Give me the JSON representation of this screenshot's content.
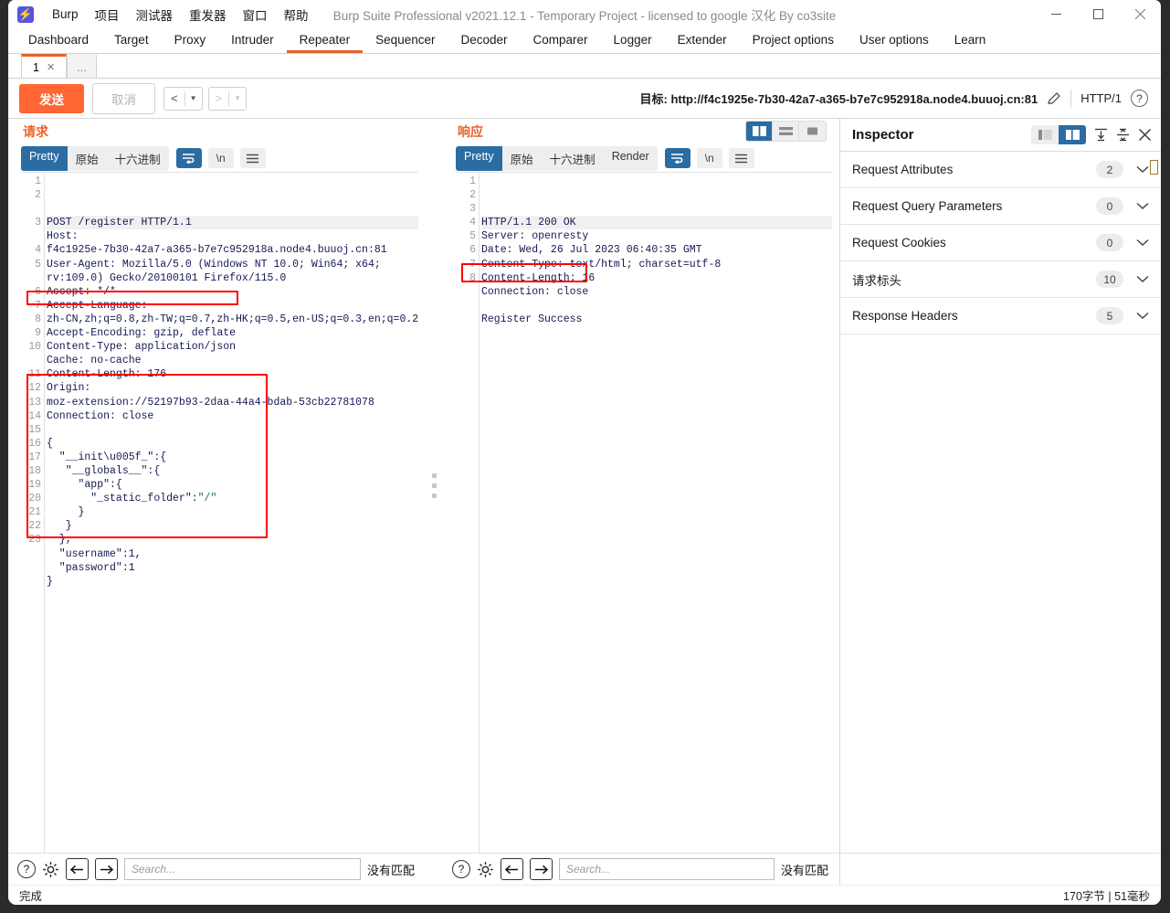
{
  "window": {
    "title": "Burp Suite Professional v2021.12.1 - Temporary Project - licensed to google 汉化 By co3site",
    "logo_glyph": "⚡",
    "minimize": "—",
    "maximize": "□",
    "close": "✕"
  },
  "menu": [
    {
      "label": "Burp"
    },
    {
      "label": "项目"
    },
    {
      "label": "测试器"
    },
    {
      "label": "重发器"
    },
    {
      "label": "窗口"
    },
    {
      "label": "帮助"
    }
  ],
  "main_tabs": [
    {
      "label": "Dashboard",
      "active": false
    },
    {
      "label": "Target",
      "active": false
    },
    {
      "label": "Proxy",
      "active": false
    },
    {
      "label": "Intruder",
      "active": false
    },
    {
      "label": "Repeater",
      "active": true
    },
    {
      "label": "Sequencer",
      "active": false
    },
    {
      "label": "Decoder",
      "active": false
    },
    {
      "label": "Comparer",
      "active": false
    },
    {
      "label": "Logger",
      "active": false
    },
    {
      "label": "Extender",
      "active": false
    },
    {
      "label": "Project options",
      "active": false
    },
    {
      "label": "User options",
      "active": false
    },
    {
      "label": "Learn",
      "active": false
    }
  ],
  "repeater_tabs": {
    "tab1_label": "1",
    "tab1_close": "✕",
    "add_tab_label": "..."
  },
  "actionbar": {
    "send_label": "发送",
    "cancel_label": "取消",
    "back_glyph": "<",
    "forward_glyph": ">",
    "caret_glyph": "▼",
    "target_label": "目标:",
    "target_url": "http://f4c1925e-7b30-42a7-a365-b7e7c952918a.node4.buuoj.cn:81",
    "http_version": "HTTP/1",
    "help_glyph": "?"
  },
  "request_panel": {
    "title": "请求",
    "tabs": [
      {
        "label": "Pretty",
        "active": true
      },
      {
        "label": "原始",
        "active": false
      },
      {
        "label": "十六进制",
        "active": false
      }
    ],
    "wrap_button": "wrap",
    "newline_button": "\\n",
    "menu_button": "menu",
    "lines": [
      {
        "n": "1",
        "text": "POST /register HTTP/1.1",
        "first": true
      },
      {
        "n": "2",
        "text": "Host:"
      },
      {
        "n": "",
        "text": "f4c1925e-7b30-42a7-a365-b7e7c952918a.node4.buuoj.cn:81"
      },
      {
        "n": "3",
        "text": "User-Agent: Mozilla/5.0 (Windows NT 10.0; Win64; x64;"
      },
      {
        "n": "",
        "text": "rv:109.0) Gecko/20100101 Firefox/115.0"
      },
      {
        "n": "4",
        "text": "Accept: */*"
      },
      {
        "n": "5",
        "text": "Accept-Language:"
      },
      {
        "n": "",
        "text": "zh-CN,zh;q=0.8,zh-TW;q=0.7,zh-HK;q=0.5,en-US;q=0.3,en;q=0.2"
      },
      {
        "n": "6",
        "text": "Accept-Encoding: gzip, deflate"
      },
      {
        "n": "7",
        "text": "Content-Type: application/json"
      },
      {
        "n": "8",
        "text": "Cache: no-cache"
      },
      {
        "n": "9",
        "text": "Content-Length: 176"
      },
      {
        "n": "10",
        "text": "Origin:"
      },
      {
        "n": "",
        "text": "moz-extension://52197b93-2daa-44a4-bdab-53cb22781078"
      },
      {
        "n": "11",
        "text": "Connection: close"
      },
      {
        "n": "12",
        "text": ""
      },
      {
        "n": "13",
        "text": "{"
      },
      {
        "n": "14",
        "text": "  \"__init\\u005f_\":{"
      },
      {
        "n": "15",
        "text": "   \"__globals__\":{"
      },
      {
        "n": "16",
        "text": "     \"app\":{"
      },
      {
        "n": "17",
        "text": "       \"_static_folder\":\"/\""
      },
      {
        "n": "18",
        "text": "     }"
      },
      {
        "n": "19",
        "text": "   }"
      },
      {
        "n": "20",
        "text": "  },"
      },
      {
        "n": "21",
        "text": "  \"username\":1,"
      },
      {
        "n": "22",
        "text": "  \"password\":1"
      },
      {
        "n": "23",
        "text": "}"
      }
    ],
    "search_placeholder": "Search...",
    "no_match": "没有匹配"
  },
  "response_panel": {
    "title": "响应",
    "tabs": [
      {
        "label": "Pretty",
        "active": true
      },
      {
        "label": "原始",
        "active": false
      },
      {
        "label": "十六进制",
        "active": false
      },
      {
        "label": "Render",
        "active": false
      }
    ],
    "layout_buttons": [
      "split-vertical",
      "split-horizontal",
      "single"
    ],
    "lines": [
      {
        "n": "1",
        "text": "HTTP/1.1 200 OK",
        "first": true
      },
      {
        "n": "2",
        "text": "Server: openresty"
      },
      {
        "n": "3",
        "text": "Date: Wed, 26 Jul 2023 06:40:35 GMT"
      },
      {
        "n": "4",
        "text": "Content-Type: text/html; charset=utf-8"
      },
      {
        "n": "5",
        "text": "Content-Length: 16"
      },
      {
        "n": "6",
        "text": "Connection: close"
      },
      {
        "n": "7",
        "text": ""
      },
      {
        "n": "8",
        "text": "Register Success"
      }
    ],
    "search_placeholder": "Search...",
    "no_match": "没有匹配"
  },
  "inspector": {
    "title": "Inspector",
    "sections": [
      {
        "label": "Request Attributes",
        "count": "2"
      },
      {
        "label": "Request Query Parameters",
        "count": "0"
      },
      {
        "label": "Request Cookies",
        "count": "0"
      },
      {
        "label": "请求标头",
        "count": "10"
      },
      {
        "label": "Response Headers",
        "count": "5"
      }
    ],
    "close_glyph": "✕"
  },
  "statusbar": {
    "left": "完成",
    "right": "170字节 | 51毫秒"
  },
  "colors": {
    "accent_orange": "#ff6633",
    "tab_indicator": "#e8632b",
    "active_blue": "#2b6ca3",
    "annotation_red": "#ff0000",
    "header_text": "#141a52",
    "string_green": "#117733"
  }
}
